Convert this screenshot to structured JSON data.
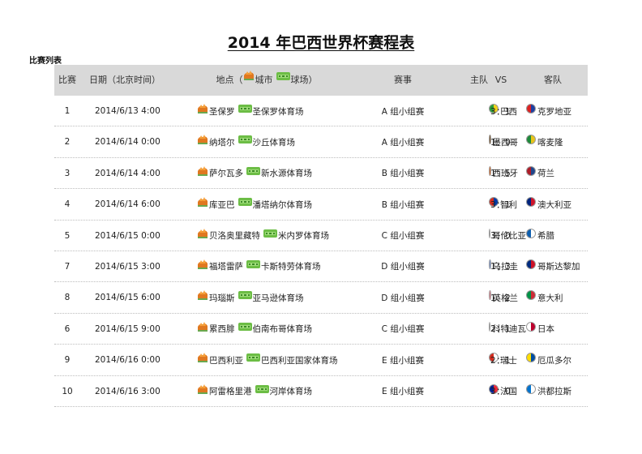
{
  "title": "2014 年巴西世界杯赛程表",
  "section_label": "比赛列表",
  "header": {
    "no": "比赛",
    "date": "日期（北京时间）",
    "loc_prefix": "地点（",
    "loc_city": "城市",
    "loc_stadium": "球场）",
    "event": "赛事",
    "home": "主队",
    "vs": "VS",
    "away": "客队"
  },
  "icons": {
    "city": "city-icon",
    "stadium": "stadium-icon",
    "flag": "team-flag-icon"
  },
  "colors": {
    "header_bg": "#d9d9d9",
    "city_icon": "#e07820",
    "stadium_icon": "#6cbd45"
  },
  "rows": [
    {
      "no": "1",
      "date": "2014/6/13 4:00",
      "city": "圣保罗",
      "stadium": "圣保罗体育场",
      "event": "A 组小组赛",
      "home": "巴西",
      "score": "3：1",
      "away": "克罗地亚",
      "home_flag": [
        "#2a9d3a",
        "#f2d21b"
      ],
      "away_flag": [
        "#d22",
        "#1f3fa0"
      ]
    },
    {
      "no": "2",
      "date": "2014/6/14 0:00",
      "city": "纳塔尔",
      "stadium": "沙丘体育场",
      "event": "A 组小组赛",
      "home": "墨西哥",
      "score": "1：0",
      "away": "喀麦隆",
      "home_flag": [
        "#1d8a3a",
        "#d22"
      ],
      "away_flag": [
        "#1d8a3a",
        "#e8c41a"
      ]
    },
    {
      "no": "3",
      "date": "2014/6/14 4:00",
      "city": "萨尔瓦多",
      "stadium": "新水源体育场",
      "event": "B 组小组赛",
      "home": "西班牙",
      "score": "1：5",
      "away": "荷兰",
      "home_flag": [
        "#c8102e",
        "#f3c41c"
      ],
      "away_flag": [
        "#ae1c28",
        "#21468b"
      ]
    },
    {
      "no": "4",
      "date": "2014/6/14 6:00",
      "city": "库亚巴",
      "stadium": "潘塔纳尔体育场",
      "event": "B 组小组赛",
      "home": "智利",
      "score": "3：1",
      "away": "澳大利亚",
      "home_flag": [
        "#d52b1e",
        "#0039a6"
      ],
      "away_flag": [
        "#00247d",
        "#cf142b"
      ]
    },
    {
      "no": "5",
      "date": "2014/6/15 0:00",
      "city": "贝洛奥里藏特",
      "stadium": "米内罗体育场",
      "event": "C 组小组赛",
      "home": "哥伦比亚",
      "score": "3：0",
      "away": "希腊",
      "home_flag": [
        "#fcd116",
        "#003893"
      ],
      "away_flag": [
        "#0d5eaf",
        "#ffffff"
      ]
    },
    {
      "no": "7",
      "date": "2014/6/15 3:00",
      "city": "福塔雷萨",
      "stadium": "卡斯特劳体育场",
      "event": "D 组小组赛",
      "home": "乌拉圭",
      "score": "1：3",
      "away": "哥斯达黎加",
      "home_flag": [
        "#0038a8",
        "#ffffff"
      ],
      "away_flag": [
        "#002b7f",
        "#ce1126"
      ]
    },
    {
      "no": "8",
      "date": "2014/6/15 6:00",
      "city": "玛瑙斯",
      "stadium": "亚马逊体育场",
      "event": "D 组小组赛",
      "home": "英格兰",
      "score": "1：2",
      "away": "意大利",
      "home_flag": [
        "#ffffff",
        "#cf142b"
      ],
      "away_flag": [
        "#009246",
        "#ce2b37"
      ]
    },
    {
      "no": "6",
      "date": "2014/6/15 9:00",
      "city": "累西腓",
      "stadium": "伯南布哥体育场",
      "event": "C 组小组赛",
      "home": "科特迪瓦",
      "score": "2：1",
      "away": "日本",
      "home_flag": [
        "#f77f00",
        "#009e60"
      ],
      "away_flag": [
        "#ffffff",
        "#bc002d"
      ]
    },
    {
      "no": "9",
      "date": "2014/6/16 0:00",
      "city": "巴西利亚",
      "stadium": "巴西利亚国家体育场",
      "event": "E 组小组赛",
      "home": "瑞士",
      "score": "2：1",
      "away": "厄瓜多尔",
      "home_flag": [
        "#d52b1e",
        "#ffffff"
      ],
      "away_flag": [
        "#ffdd00",
        "#034ea2"
      ]
    },
    {
      "no": "10",
      "date": "2014/6/16 3:00",
      "city": "阿雷格里港",
      "stadium": "河岸体育场",
      "event": "E 组小组赛",
      "home": "法国",
      "score": "3：0",
      "away": "洪都拉斯",
      "home_flag": [
        "#002395",
        "#ed2939"
      ],
      "away_flag": [
        "#0073cf",
        "#ffffff"
      ]
    }
  ]
}
